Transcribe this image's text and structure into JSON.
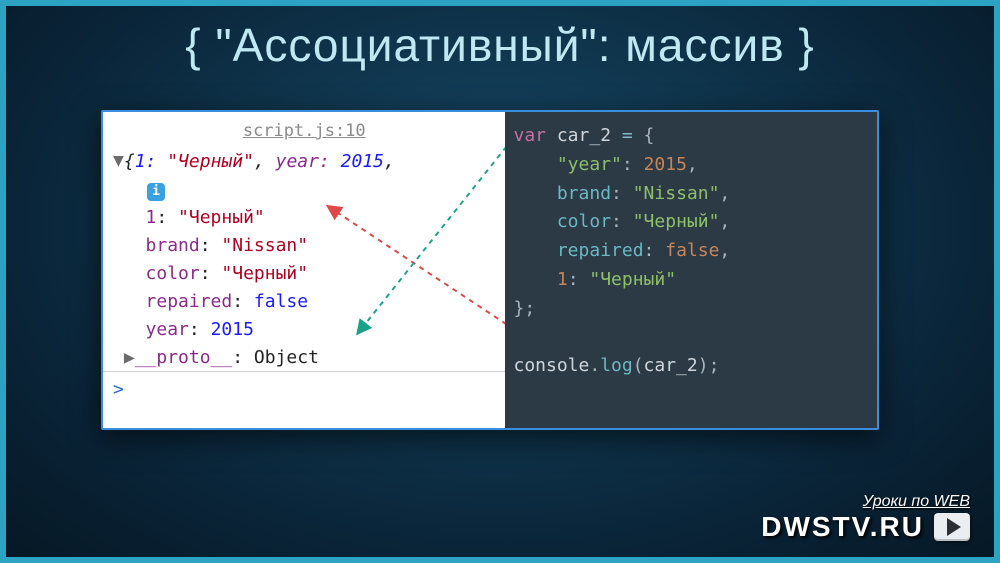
{
  "title": "{ \"Ассоциативный\": массив }",
  "console": {
    "file": "script.js:10",
    "summary_prefix": "{",
    "summary_key1": "1:",
    "summary_val1": "\"Черный\"",
    "summary_sep": ", ",
    "summary_key2": "year:",
    "summary_val2": "2015",
    "summary_trail": ",",
    "info_badge": "i",
    "p1_key": "1",
    "p1_val": "\"Черный\"",
    "p2_key": "brand",
    "p2_val": "\"Nissan\"",
    "p3_key": "color",
    "p3_val": "\"Черный\"",
    "p4_key": "repaired",
    "p4_val": "false",
    "p5_key": "year",
    "p5_val": "2015",
    "proto_key": "__proto__",
    "proto_val": "Object",
    "prompt": ">"
  },
  "editor": {
    "kw_var": "var",
    "varname": "car_2",
    "eq": " = ",
    "brace_open": "{",
    "k_year": "\"year\"",
    "v_year": "2015",
    "k_brand": "brand",
    "v_brand": "\"Nissan\"",
    "k_color": "color",
    "v_color": "\"Черный\"",
    "k_repaired": "repaired",
    "v_repaired": "false",
    "k_one": "1",
    "v_one": "\"Черный\"",
    "brace_close": "};",
    "log_obj": "console",
    "log_fn": "log",
    "log_arg": "car_2",
    "paren_open": "(",
    "paren_close": ");",
    "dot": ".",
    "colon": ": ",
    "comma": ","
  },
  "watermark": {
    "sub": "Уроки по WEB",
    "main": "DWSTV.RU"
  }
}
